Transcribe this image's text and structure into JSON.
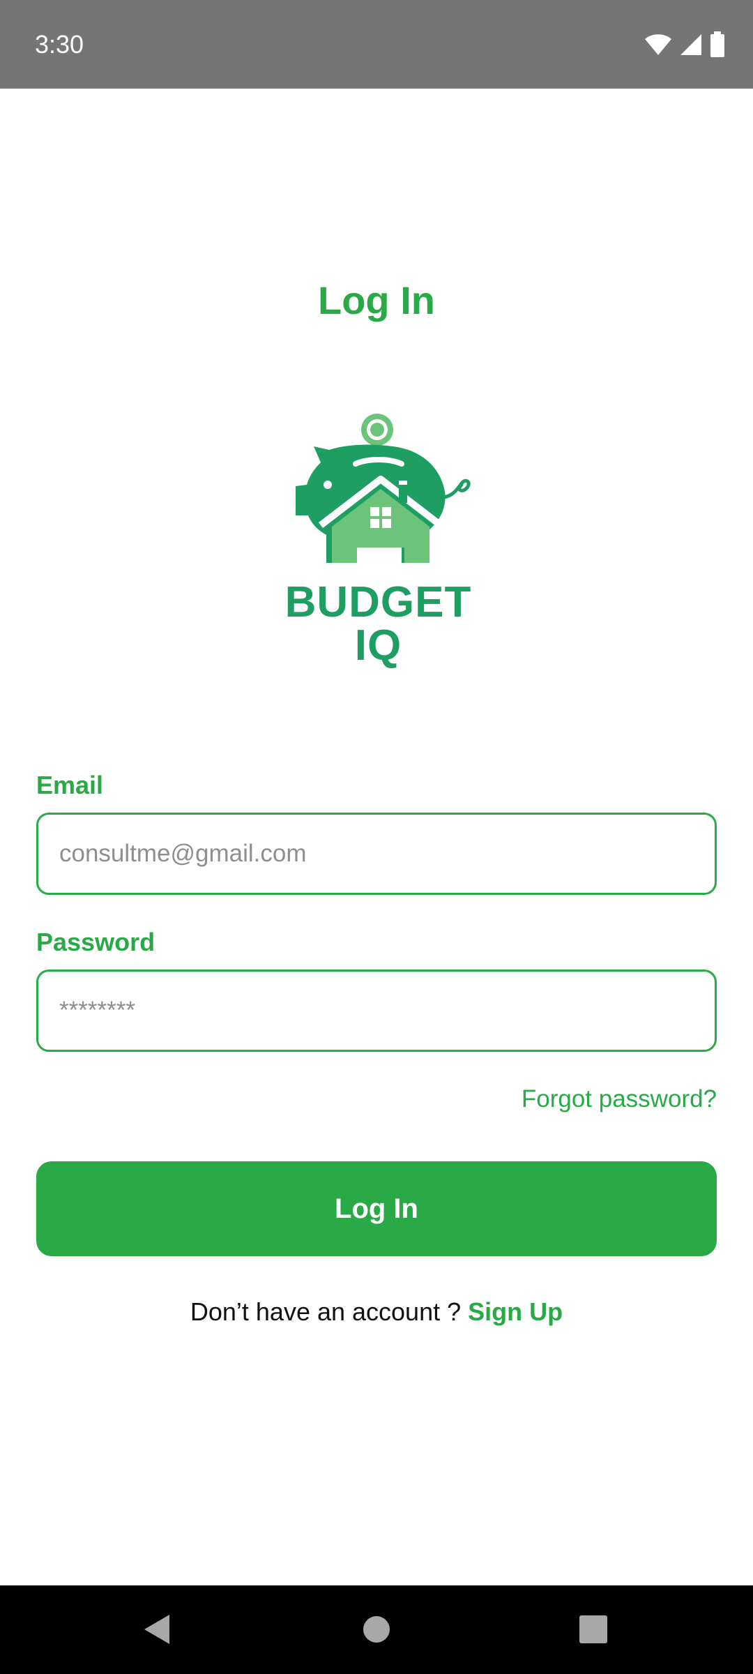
{
  "status_bar": {
    "time": "3:30",
    "icons": [
      "wifi-icon",
      "cellular-signal-icon",
      "battery-icon"
    ]
  },
  "page": {
    "title": "Log In"
  },
  "logo": {
    "line1": "BUDGET",
    "line2": "IQ",
    "icon": "piggy-bank-house-icon"
  },
  "form": {
    "email_label": "Email",
    "email_placeholder": "consultme@gmail.com",
    "email_value": "",
    "password_label": "Password",
    "password_placeholder": "********",
    "password_value": "",
    "forgot_password": "Forgot password?",
    "submit_label": "Log In"
  },
  "signup": {
    "prompt": "Don’t have an account ? ",
    "link": "Sign Up"
  },
  "nav_bar": {
    "icons": [
      "back-icon",
      "home-icon",
      "recents-icon"
    ]
  },
  "colors": {
    "accent": "#2aa947",
    "logo_dark_green": "#1f9e63",
    "logo_light_green": "#6cc47a",
    "status_bar": "#757575",
    "nav_bar": "#000000"
  }
}
